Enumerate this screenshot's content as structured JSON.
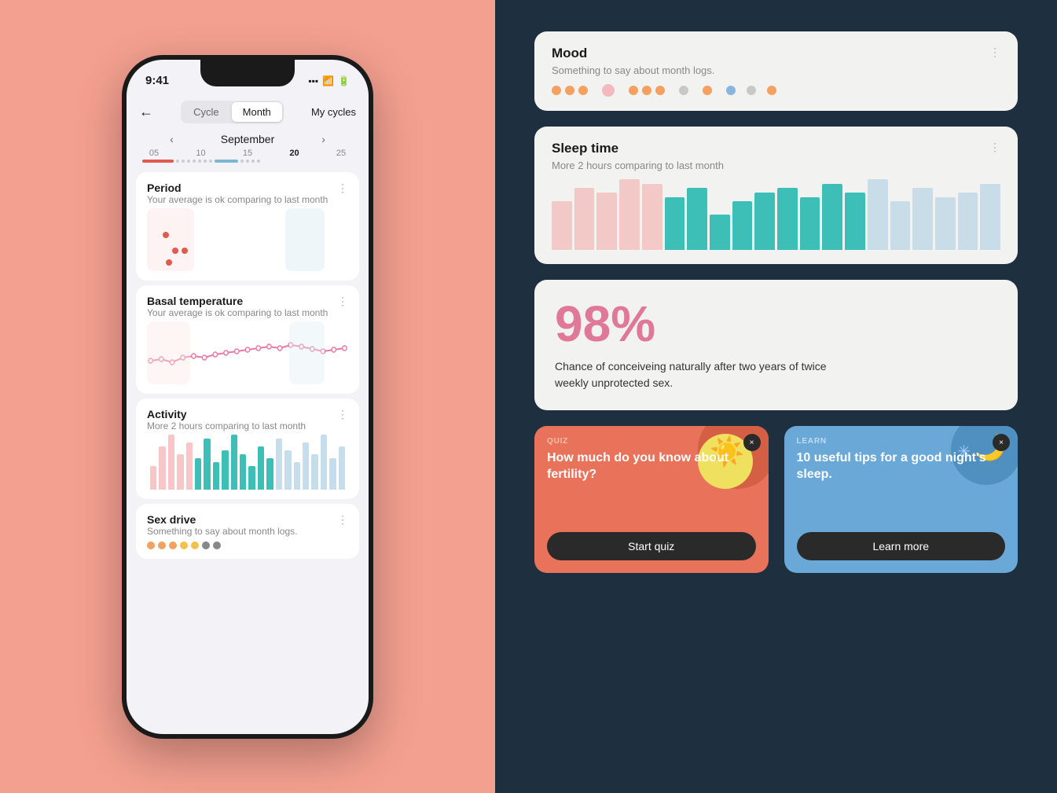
{
  "left": {
    "background_color": "#f4a090",
    "phone": {
      "status_bar": {
        "time": "9:41",
        "signal_icon": "signal-icon",
        "wifi_icon": "wifi-icon",
        "battery_icon": "battery-icon"
      },
      "header": {
        "back_label": "←",
        "toggle_cycle": "Cycle",
        "toggle_month": "Month",
        "my_cycles_label": "My cycles"
      },
      "calendar": {
        "prev_arrow": "‹",
        "next_arrow": "›",
        "month_label": "September",
        "day_numbers": [
          "05",
          "10",
          "15",
          "20",
          "25"
        ]
      },
      "cards": [
        {
          "id": "period",
          "title": "Period",
          "subtitle": "Your average is ok comparing to last month",
          "menu_icon": "⋮"
        },
        {
          "id": "basal-temperature",
          "title": "Basal temperature",
          "subtitle": "Your average is ok comparing to last month",
          "menu_icon": "⋮"
        },
        {
          "id": "activity",
          "title": "Activity",
          "subtitle": "More 2 hours comparing to last month",
          "menu_icon": "⋮"
        },
        {
          "id": "sex-drive",
          "title": "Sex drive",
          "subtitle": "Something to say about month logs.",
          "menu_icon": "⋮"
        }
      ]
    }
  },
  "right": {
    "background_color": "#1e3040",
    "cards": [
      {
        "id": "mood",
        "title": "Mood",
        "subtitle": "Something to say about month logs.",
        "menu_icon": "⋮"
      },
      {
        "id": "sleep-time",
        "title": "Sleep time",
        "subtitle": "More 2 hours comparing to last month",
        "menu_icon": "⋮"
      },
      {
        "id": "fertility",
        "percent": "98%",
        "description": "Chance of conceiveing naturally after two years of twice weekly unprotected sex."
      }
    ],
    "quiz_card": {
      "tag": "QUIZ",
      "title": "How much do you know about fertility?",
      "button_label": "Start quiz",
      "close_icon": "×"
    },
    "learn_card": {
      "tag": "LEARN",
      "title": "10 useful tips for a good night's sleep.",
      "button_label": "Learn more",
      "close_icon": "×"
    }
  },
  "activity_bars": [
    30,
    55,
    70,
    45,
    60,
    40,
    65,
    35,
    50,
    70,
    45,
    30,
    55,
    40,
    65,
    50,
    35,
    60,
    45,
    70,
    40,
    55
  ],
  "sleep_bars": [
    55,
    70,
    65,
    80,
    75,
    60,
    70,
    40,
    55,
    65,
    70,
    60,
    75,
    65,
    80,
    55,
    70,
    60,
    65,
    75
  ],
  "mood_dots_right": [
    {
      "color": "#f4a060",
      "size": 12
    },
    {
      "color": "#f4a060",
      "size": 12
    },
    {
      "color": "#f4a060",
      "size": 12
    },
    {
      "color": "#f4c0c8",
      "size": 18
    },
    {
      "color": "#f4a060",
      "size": 12
    },
    {
      "color": "#f4a060",
      "size": 12
    },
    {
      "color": "#f4a060",
      "size": 12
    },
    {
      "color": "#c8c8c8",
      "size": 10
    },
    {
      "color": "#f4a060",
      "size": 12
    },
    {
      "color": "#c8c8c8",
      "size": 10
    },
    {
      "color": "#c8c8c8",
      "size": 10
    }
  ]
}
